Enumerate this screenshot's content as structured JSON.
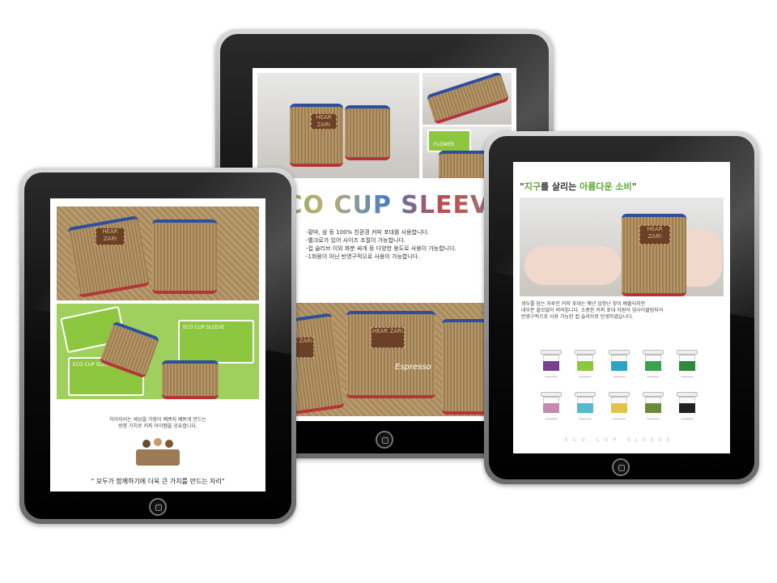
{
  "center_tablet": {
    "title": "ECO CUP SLEEVE",
    "bullets": [
      "-황마, 삼 등 100% 친환경 커피 포대를 사용합니다.",
      "-벨크로가 있어 사이즈 조절이 가능합니다.",
      "-컵 슬리브 이외 화분 싸개 등 다양한 용도로 사용이 가능합니다.",
      "-1회용이 아닌 반영구적으로 사용이 가능합니다."
    ],
    "patch_text": "HEAR ZARI",
    "flower_text": "FLOWER",
    "espresso_text": "Espresso"
  },
  "left_tablet": {
    "caption_lines": [
      "히어자리는 세상을 가장이 예쁘지 예쁘게 만드는",
      "방향 가치로 커피 아이템을 공유합니다."
    ],
    "quote": "\" 모두가 함께하기에 더욱 큰 가치를 만드는 자리\"",
    "card_text": "ECO CUP SLEEVE",
    "patch_text": "HEAR ZARI"
  },
  "right_tablet": {
    "headline_parts": [
      "\"",
      "지구",
      "를 살리는 ",
      "아름다운 소비",
      "\""
    ],
    "patch_text": "HEAR ZARI",
    "body_lines": [
      "생두를 담는 자루인 커피 포대는 매년 엄청난 양이 배출되지만",
      "대부분 쓸모없이 버려집니다. 소중한 커피 포대 자원이 업사이클링되어",
      "반영구적으로 사용 가능한 컵 슬리브로 탄생하였습니다."
    ],
    "footer_label": "ECO CUP SLEEVE",
    "cup_band_colors": [
      "#7a3f8f",
      "#8dc63f",
      "#2fa3c6",
      "#3aa24a",
      "#2e8a3a",
      "#c58ab0",
      "#5bb7d0",
      "#e3c24a",
      "#6a8a3a",
      "#222222"
    ]
  }
}
